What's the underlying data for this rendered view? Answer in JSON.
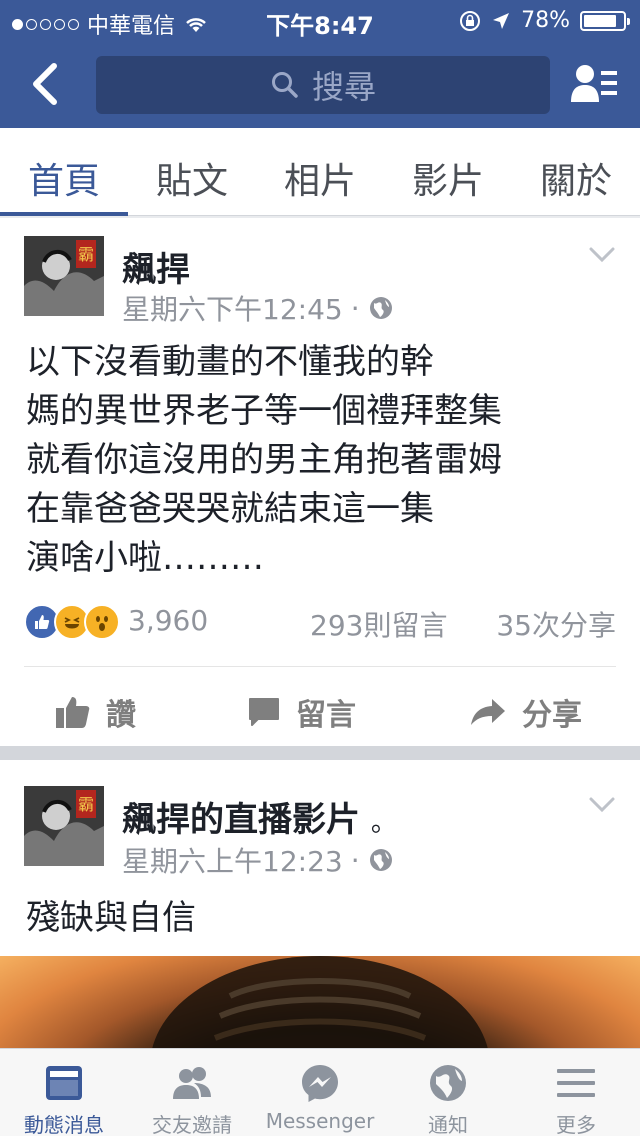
{
  "status_bar": {
    "carrier": "中華電信",
    "time": "下午8:47",
    "battery": "78%",
    "battery_level": 0.78
  },
  "nav": {
    "search_label": "搜尋"
  },
  "tabs": [
    {
      "label": "首頁"
    },
    {
      "label": "貼文"
    },
    {
      "label": "相片"
    },
    {
      "label": "影片"
    },
    {
      "label": "關於"
    }
  ],
  "posts": [
    {
      "author": "飆捍",
      "time": "星期六下午12:45",
      "separator": "·",
      "text_lines": [
        "以下沒看動畫的不懂我的幹",
        "媽的異世界老子等一個禮拜整集",
        "就看你這沒用的男主角抱著雷姆",
        "在靠爸爸哭哭就結束這一集",
        "演啥小啦………"
      ],
      "reaction_count": "3,960",
      "comments": "293則留言",
      "shares": "35次分享",
      "actions": {
        "like": "讚",
        "comment": "留言",
        "share": "分享"
      }
    },
    {
      "author": "飆捍的直播影片",
      "live_dot": "。",
      "time": "星期六上午12:23",
      "separator": "·",
      "text": "殘缺與自信"
    }
  ],
  "bottom_tabs": [
    {
      "label": "動態消息",
      "icon": "news-feed-icon"
    },
    {
      "label": "交友邀請",
      "icon": "friend-requests-icon"
    },
    {
      "label": "Messenger",
      "icon": "messenger-icon"
    },
    {
      "label": "通知",
      "icon": "globe-notifications-icon"
    },
    {
      "label": "更多",
      "icon": "menu-icon"
    }
  ],
  "colors": {
    "brand": "#3b5998",
    "background": "#e9ebee",
    "muted_text": "#90949c"
  }
}
